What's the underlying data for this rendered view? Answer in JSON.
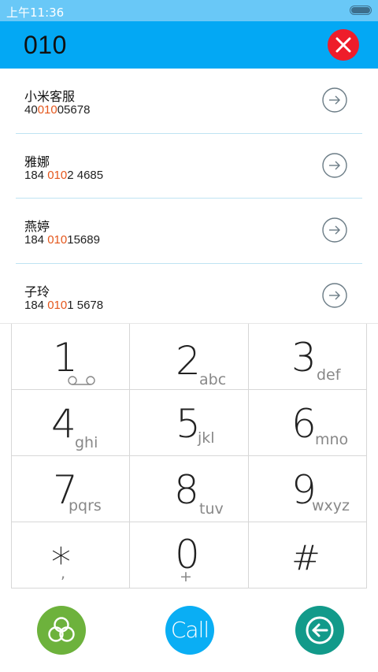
{
  "status_bar": {
    "time": "上午11:36"
  },
  "dial": {
    "input": "010"
  },
  "contacts": [
    {
      "name": "小米客服",
      "number_pre": "40",
      "number_match": "010",
      "number_post": "05678"
    },
    {
      "name": "雅娜",
      "number_pre": "184 ",
      "number_match": "010",
      "number_post": "2 4685"
    },
    {
      "name": "燕婷",
      "number_pre": "184 ",
      "number_match": "010",
      "number_post": "15689"
    },
    {
      "name": "子玲",
      "number_pre": "184 ",
      "number_match": "010",
      "number_post": "1 5678"
    }
  ],
  "keypad": [
    {
      "digit": "1",
      "letters": ""
    },
    {
      "digit": "2",
      "letters": "abc"
    },
    {
      "digit": "3",
      "letters": "def"
    },
    {
      "digit": "4",
      "letters": "ghi"
    },
    {
      "digit": "5",
      "letters": "jkl"
    },
    {
      "digit": "6",
      "letters": "mno"
    },
    {
      "digit": "7",
      "letters": "pqrs"
    },
    {
      "digit": "8",
      "letters": "tuv"
    },
    {
      "digit": "9",
      "letters": "wxyz"
    },
    {
      "digit": "*",
      "letters": ","
    },
    {
      "digit": "0",
      "letters": "+"
    },
    {
      "digit": "#",
      "letters": ""
    }
  ],
  "actions": {
    "call_label": "Call"
  },
  "colors": {
    "status_bar": "#69c8f7",
    "header": "#03a8f4",
    "clear": "#ee1d2a",
    "match_highlight": "#e4561b",
    "contacts_button": "#6db23c",
    "call_button": "#0aaef4",
    "back_button": "#129a8a"
  },
  "icons": [
    "battery-icon",
    "close-icon",
    "arrow-right-circle-icon",
    "voicemail-icon",
    "contacts-icon",
    "backspace-icon"
  ]
}
